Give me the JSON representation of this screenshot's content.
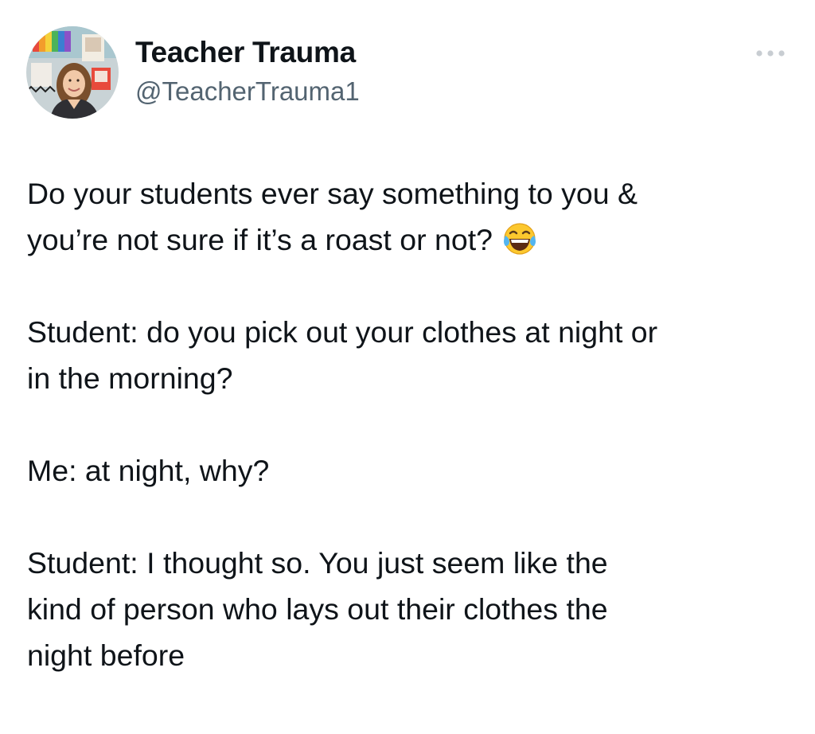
{
  "tweet": {
    "author": {
      "name": "Teacher Trauma",
      "handle": "@TeacherTrauma1"
    },
    "more_icon": "more-horizontal-icon",
    "paragraphs": {
      "p1_l1": "Do your students ever say something to you &",
      "p1_l2": "you’re not sure if it’s a roast or not?",
      "p1_emoji": "face-with-tears-of-joy-emoji",
      "p2_l1": "Student: do you pick out your clothes at night or",
      "p2_l2": "in the morning?",
      "p3_l1": "Me: at night, why?",
      "p4_l1": "Student: I thought so. You just seem like the",
      "p4_l2": "kind of person who lays out their clothes the",
      "p4_l3": "night before"
    }
  }
}
